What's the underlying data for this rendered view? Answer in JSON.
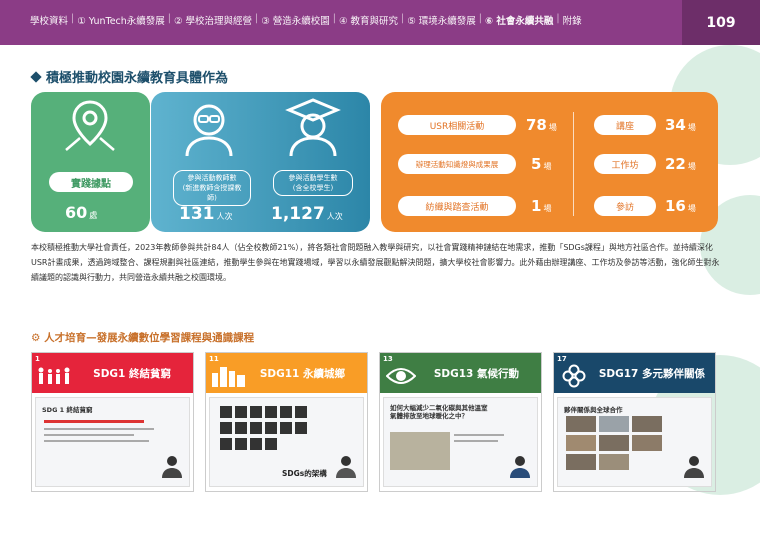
{
  "header": {
    "nav": [
      {
        "label": "學校資料"
      },
      {
        "label": "① YunTech永續發展"
      },
      {
        "label": "② 學校治理與經營"
      },
      {
        "label": "③ 營造永續校園"
      },
      {
        "label": "④ 教育與研究"
      },
      {
        "label": "⑤ 環境永續發展"
      },
      {
        "label": "⑥ 社會永續共融",
        "active": true
      },
      {
        "label": "附錄"
      }
    ],
    "page_number": "109"
  },
  "section_title": "積極推動校園永續教育具體作為",
  "stats": {
    "field": {
      "label": "實踐據點",
      "value": "60",
      "unit": "處"
    },
    "teachers": {
      "caption": "參與活動教師數\n(新進教師含授課教師)",
      "value": "131",
      "unit": "人次"
    },
    "students": {
      "caption": "參與活動學生數\n(含全校學生)",
      "value": "1,127",
      "unit": "人次"
    },
    "items": [
      {
        "label": "USR相關活動",
        "value": "78",
        "unit": "場"
      },
      {
        "label": "辦理活動知識燈與成果展",
        "value": "5",
        "unit": "場"
      },
      {
        "label": "紡織與踏查活動",
        "value": "1",
        "unit": "場"
      },
      {
        "label": "講座",
        "value": "34",
        "unit": "場"
      },
      {
        "label": "工作坊",
        "value": "22",
        "unit": "場"
      },
      {
        "label": "參訪",
        "value": "16",
        "unit": "場"
      }
    ]
  },
  "paragraph": "本校積極推動大學社會責任，2023年教師參與共計84人（佔全校教師21%），將各類社會問題融入教學與研究，以社會實踐精神鏈結在地需求，推動「SDGs課程」與地方社區合作。並持續深化USR計畫成果，透過跨域整合、課程規劃與社區連結，推動學生參與在地實踐場域，學習以永續發展觀點解決問題，擴大學校社會影響力。此外藉由辦理講座、工作坊及參訪等活動，強化師生對永續議題的認識與行動力，共同營造永續共融之校園環境。",
  "subsection_title": "人才培育—發展永續數位學習課程與通識課程",
  "courses": [
    {
      "number": "1",
      "title": "SDG1 終結貧窮",
      "color": "#e5243b",
      "slide_title": "SDG 1 終結貧窮",
      "slide_caption": ""
    },
    {
      "number": "11",
      "title": "SDG11 永續城鄉",
      "color": "#f99d26",
      "slide_title": "",
      "slide_caption": "SDGs的架構"
    },
    {
      "number": "13",
      "title": "SDG13 氣候行動",
      "color": "#3f7e44",
      "slide_title": "如何大幅減少二氧化碳與其他溫室氣體排放至地球暖化之中？",
      "slide_caption": ""
    },
    {
      "number": "17",
      "title": "SDG17 多元夥伴關係",
      "color": "#19486a",
      "slide_title": "夥伴關係與全球合作",
      "slide_caption": ""
    }
  ]
}
